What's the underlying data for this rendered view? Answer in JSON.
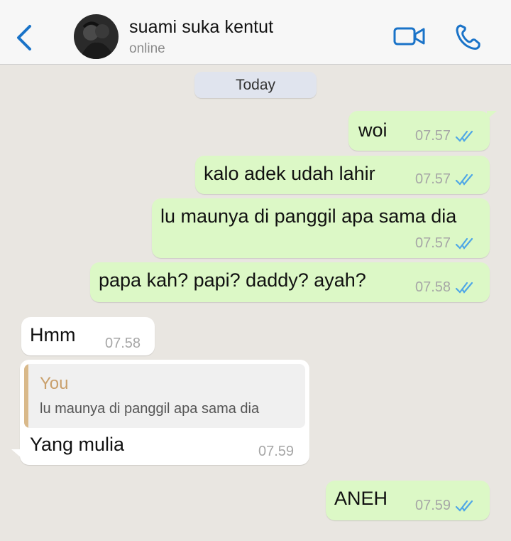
{
  "header": {
    "contact_name": "suami suka kentut",
    "status": "online",
    "icons": [
      "chevron-left-icon",
      "avatar",
      "video-call-icon",
      "phone-icon"
    ],
    "accent": "#1a73c8"
  },
  "date_chip": "Today",
  "messages": [
    {
      "direction": "outgoing",
      "text": "woi",
      "time": "07.57",
      "read": true
    },
    {
      "direction": "outgoing",
      "text": "kalo adek udah lahir",
      "time": "07.57",
      "read": true
    },
    {
      "direction": "outgoing",
      "text": "lu maunya di panggil apa sama dia",
      "time": "07.57",
      "read": true
    },
    {
      "direction": "outgoing",
      "text": "papa kah? papi? daddy? ayah?",
      "time": "07.58",
      "read": true
    },
    {
      "direction": "incoming",
      "text": "Hmm",
      "time": "07.58"
    },
    {
      "direction": "incoming",
      "text": "Yang mulia",
      "time": "07.59",
      "reply_to": {
        "author": "You",
        "text": "lu maunya di panggil apa sama dia"
      }
    },
    {
      "direction": "outgoing",
      "text": "ANEH",
      "time": "07.59",
      "read": true
    }
  ],
  "colors": {
    "outgoing_bubble": "#dcf8c6",
    "incoming_bubble": "#ffffff",
    "background": "#e9e6e1",
    "read_ticks": "#4fa7e6",
    "quote_accent": "#d9b98a"
  }
}
